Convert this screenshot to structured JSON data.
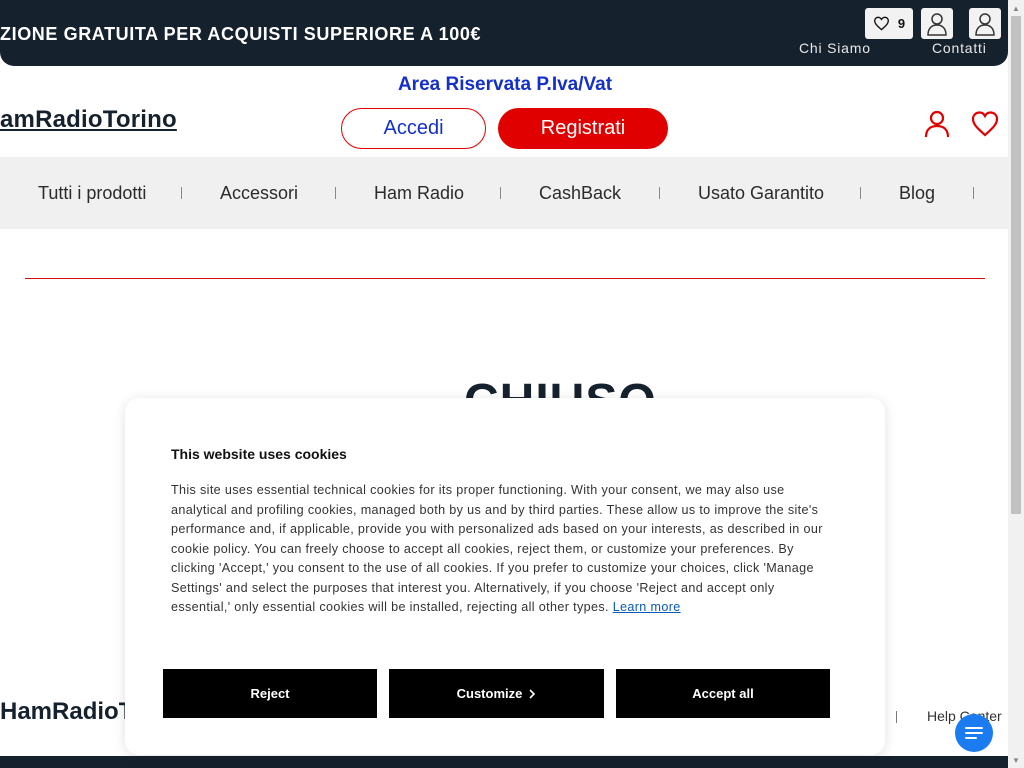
{
  "topbar": {
    "promo_text": "ZIONE GRATUITA PER ACQUISTI SUPERIORE A 100€",
    "wishlist_count": "9",
    "links": [
      "Chi Siamo",
      "Contatti"
    ]
  },
  "header": {
    "logo": "amRadioTorino",
    "area_label": "Area Riservata P.Iva/Vat",
    "login_label": "Accedi",
    "register_label": "Registrati"
  },
  "nav": {
    "items": [
      "Tutti i prodotti",
      "Accessori",
      "Ham Radio",
      "CashBack",
      "Usato Garantito",
      "Blog"
    ]
  },
  "main": {
    "title": "CHIUSO"
  },
  "cookie": {
    "title": "This website uses cookies",
    "body": "This site uses essential technical cookies for its proper functioning. With your consent, we may also use analytical and profiling cookies, managed both by us and by third parties. These allow us to improve the site's performance and, if applicable, provide you with personalized ads based on your interests, as described in our cookie policy. You can freely choose to accept all cookies, reject them, or customize your preferences. By clicking 'Accept,' you consent to the use of all cookies. If you prefer to customize your choices, click 'Manage Settings' and select the purposes that interest you. Alternatively, if you choose 'Reject and accept only essential,' only essential cookies will be installed, rejecting all other types.",
    "learn_more": "Learn more",
    "reject_label": "Reject",
    "customize_label": "Customize",
    "accept_label": "Accept all"
  },
  "footer": {
    "logo": "HamRadioT",
    "help_link": "Help Center"
  },
  "colors": {
    "brand_dark": "#16212e",
    "accent_red": "#e00000",
    "accent_blue": "#1530c8",
    "chat_blue": "#1a7cf0"
  }
}
